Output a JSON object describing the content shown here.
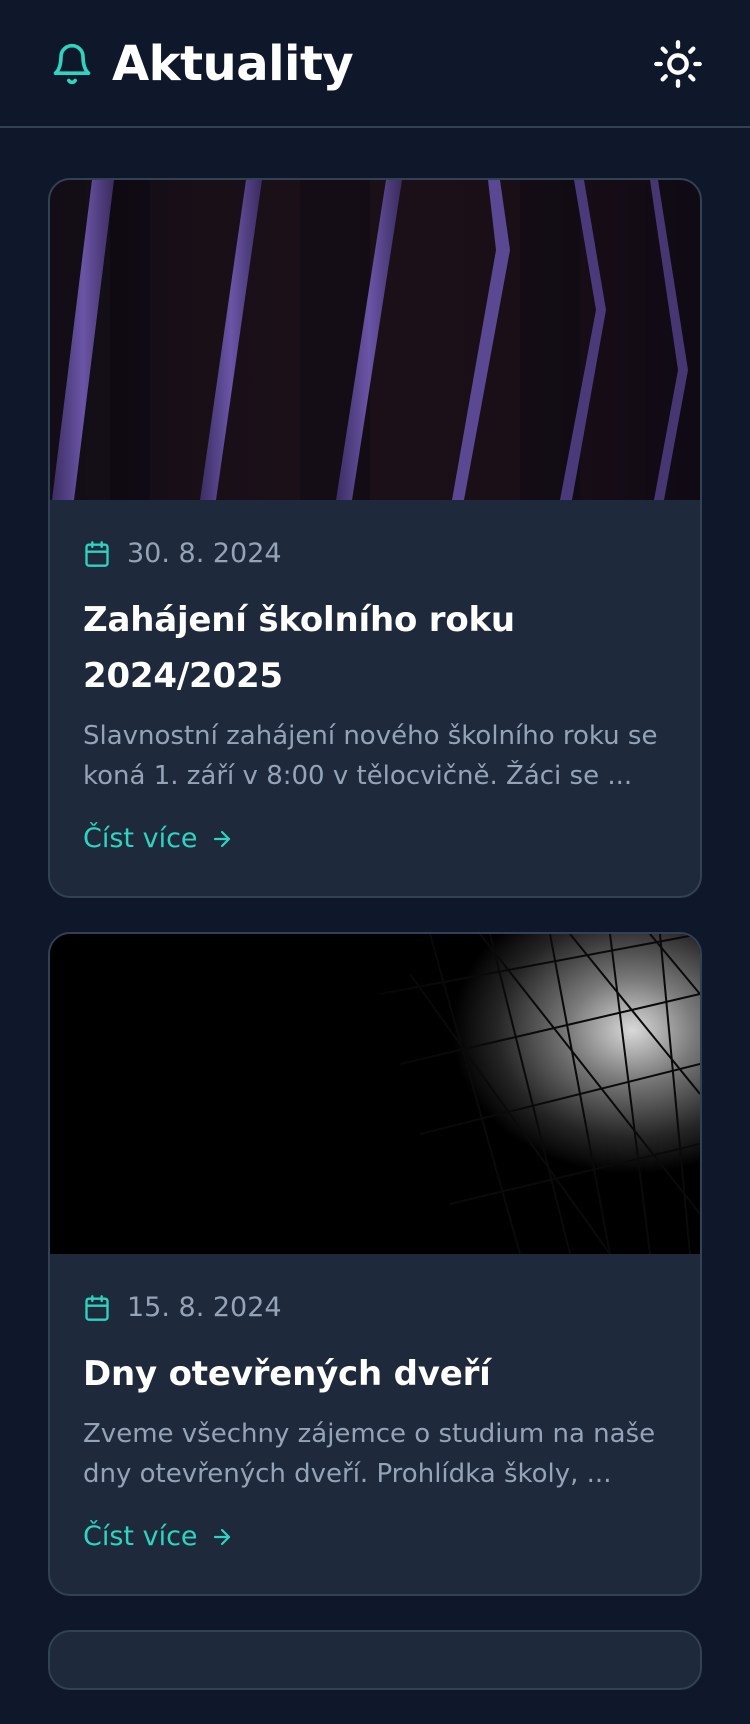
{
  "header": {
    "title": "Aktuality",
    "icon": "bell-icon",
    "theme_toggle_icon": "sun-icon"
  },
  "colors": {
    "background": "#0f172a",
    "card": "#1e293b",
    "border": "#334155",
    "accent": "#2dd4bf",
    "muted_text": "#94a3b8",
    "title_text": "#ffffff"
  },
  "news": [
    {
      "date": "30. 8. 2024",
      "title": "Zahájení školního roku 2024/2025",
      "excerpt": "Slavnostní zahájení nového školního roku se koná 1. září v 8:00 v tělocvičně. Žáci se ...",
      "link_label": "Číst více",
      "image": "purple-angled-beams-photo"
    },
    {
      "date": "15. 8. 2024",
      "title": "Dny otevřených dveří",
      "excerpt": "Zveme všechny zájemce o studium na naše dny otevřených dveří. Prohlídka školy, ...",
      "link_label": "Číst více",
      "image": "geometric-glass-facade-photo"
    }
  ]
}
